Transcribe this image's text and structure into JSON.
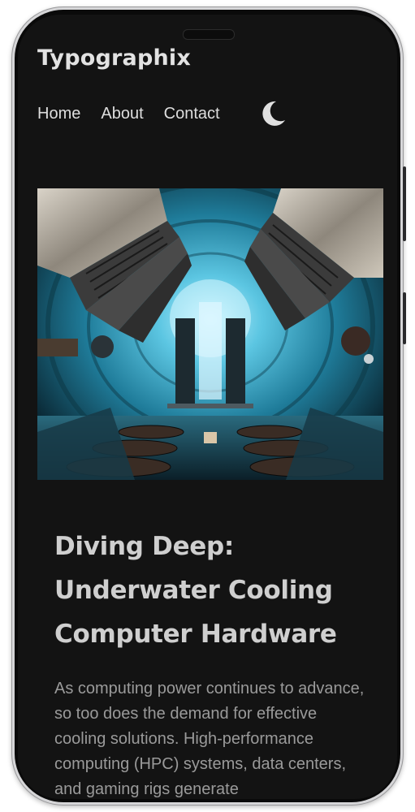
{
  "site": {
    "brand": "Typographix"
  },
  "nav": {
    "items": [
      {
        "label": "Home"
      },
      {
        "label": "About"
      },
      {
        "label": "Contact"
      }
    ],
    "theme_toggle_icon": "moon-icon"
  },
  "article": {
    "hero_image_alt_icon": "vacuum-chamber-photo",
    "title": "Diving Deep: Underwater Cooling Computer Hardware",
    "excerpt": "As computing power continues to advance, so too does the demand for effective cooling solutions. High-performance computing (HPC) systems, data centers, and gaming rigs generate"
  },
  "colors": {
    "background": "#131313",
    "brand_text": "#e2e2e2",
    "nav_text": "#dedede",
    "headline": "#cfcfcf",
    "body_text": "#9a9a9a",
    "hero_accent": "#39b4d4"
  }
}
